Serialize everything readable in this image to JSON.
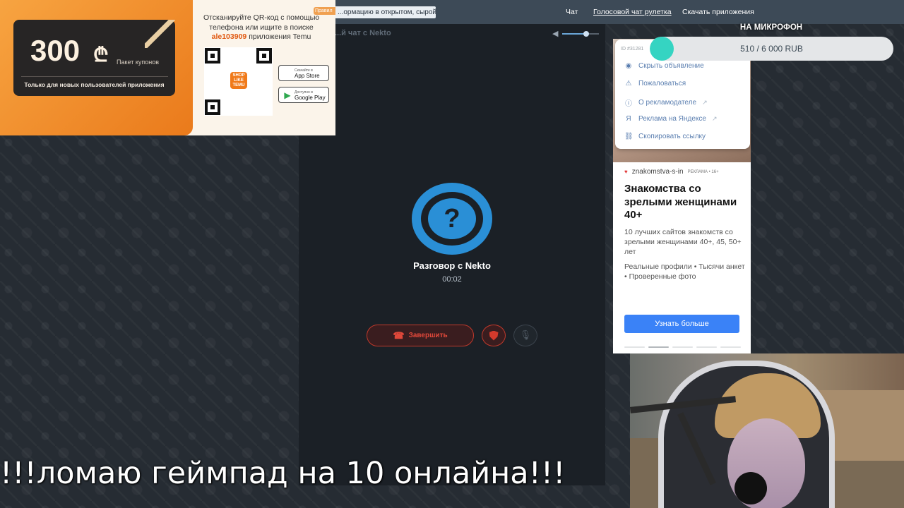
{
  "topbar": {
    "notice": "...ормацию в открытом, сырой виде!",
    "nav": [
      "Чат",
      "Голосовой чат рулетка",
      "Скачать приложения"
    ]
  },
  "chat": {
    "header_title": "...й чат с Nekto",
    "conversation_title": "Разговор с Nekto",
    "timer": "00:02",
    "end_button": "Завершить",
    "avatar_glyph": "?",
    "volume_level": 0.65
  },
  "temu_ad": {
    "amount": "300",
    "currency_glyph": "₾",
    "pack_label": "Пакет купонов",
    "only_new": "Только для новых пользователей приложения",
    "scan_text_1": "Отсканируйте QR-код с помощью телефона или ищите в поиске",
    "code": "ale103909",
    "scan_text_2": "приложения Temu",
    "badge": "Правил",
    "qr_logo": "SHOP LIKE TEMU",
    "app_store_small": "Скачайте в",
    "app_store": "App Store",
    "google_play_small": "Доступно в",
    "google_play": "Google Play"
  },
  "donation_goal": {
    "label": "НА МИКРОФОН",
    "text": "510 / 6 000 RUB",
    "progress": 0.085
  },
  "yandex_ad": {
    "id": "ID #31281",
    "menu": [
      {
        "icon": "eye-off-icon",
        "glyph": "◉",
        "label": "Скрыть объявление",
        "external": false
      },
      {
        "icon": "warning-icon",
        "glyph": "⚠",
        "label": "Пожаловаться",
        "external": false
      },
      {
        "icon": "info-icon",
        "glyph": "ⓘ",
        "label": "О рекламодателе",
        "external": true
      },
      {
        "icon": "yandex-icon",
        "glyph": "Я",
        "label": "Реклама на Яндексе",
        "external": true
      },
      {
        "icon": "link-icon",
        "glyph": "⛓",
        "label": "Скопировать ссылку",
        "external": false
      }
    ],
    "domain": "znakomstva-s-in",
    "age_label": "РЕКЛАМА • 16+",
    "headline": "Знакомства со зрелыми женщинами 40+",
    "description": "10 лучших сайтов знакомств со зрелыми женщинами 40+, 45, 50+ лет",
    "features": "Реальные профили • Тысячи анкет • Проверенные фото",
    "cta": "Узнать больше"
  },
  "stream_title": "!!!ломаю геймпад на 10 онлайна!!!"
}
